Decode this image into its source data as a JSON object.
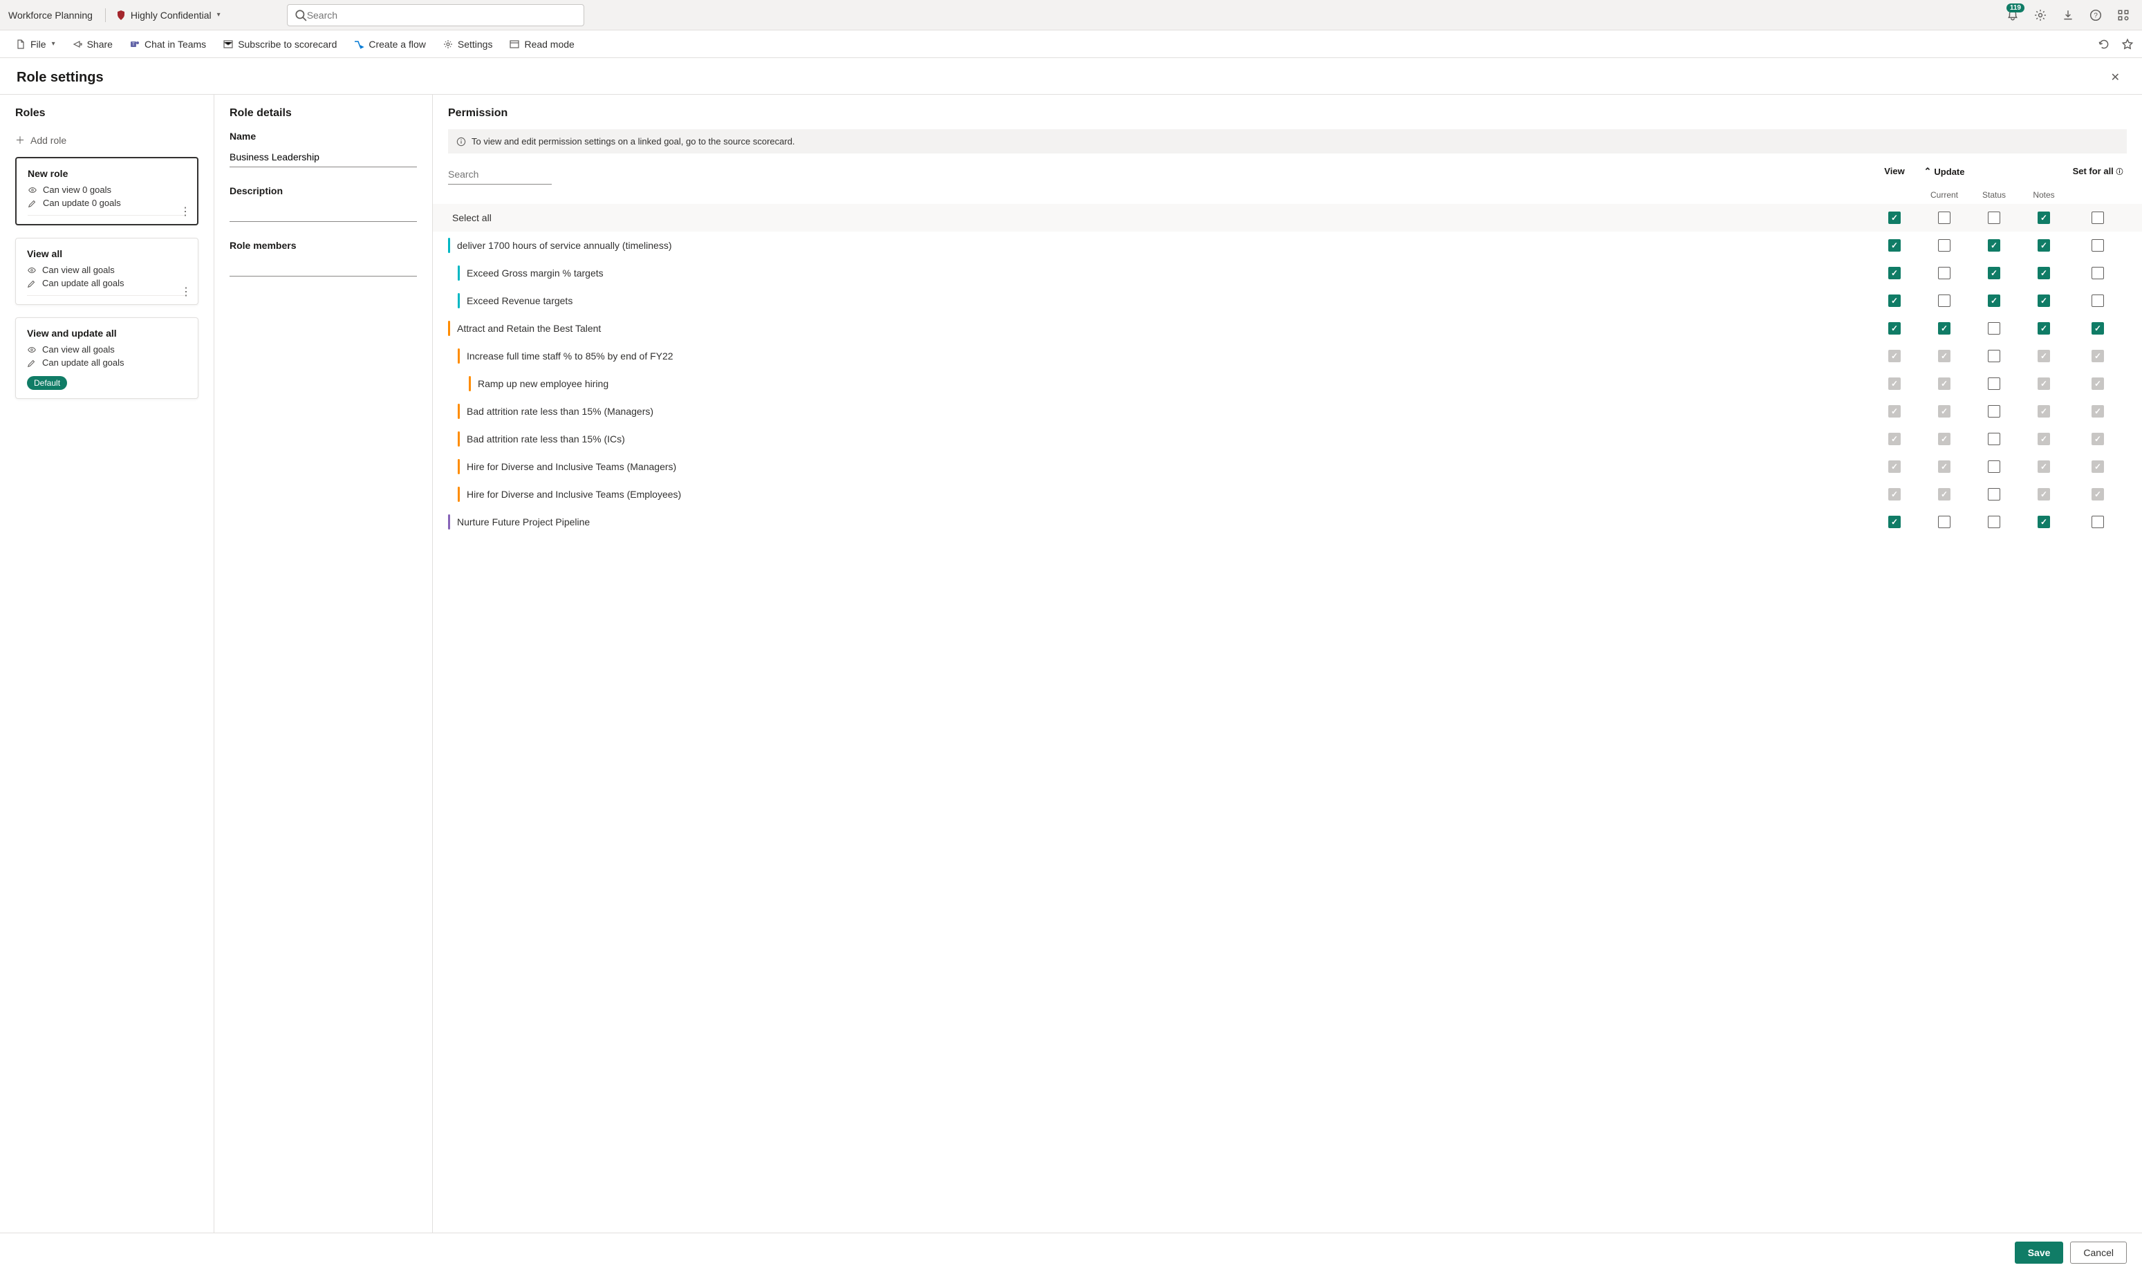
{
  "header": {
    "app_name": "Workforce Planning",
    "sensitivity": "Highly Confidential",
    "search_placeholder": "Search",
    "badge_count": "119"
  },
  "toolbar": {
    "file": "File",
    "share": "Share",
    "chat": "Chat in Teams",
    "subscribe": "Subscribe to scorecard",
    "flow": "Create a flow",
    "settings": "Settings",
    "readmode": "Read mode"
  },
  "panel": {
    "title": "Role settings",
    "save": "Save",
    "cancel": "Cancel"
  },
  "roles": {
    "heading": "Roles",
    "add": "Add role",
    "default_label": "Default",
    "cards": [
      {
        "name": "New role",
        "view_line": "Can view 0 goals",
        "update_line": "Can update 0 goals",
        "selected": true,
        "kebab": true
      },
      {
        "name": "View all",
        "view_line": "Can view all goals",
        "update_line": "Can update all goals",
        "selected": false,
        "kebab": true
      },
      {
        "name": "View and update all",
        "view_line": "Can view all goals",
        "update_line": "Can update all goals",
        "selected": false,
        "default": true
      }
    ]
  },
  "details": {
    "heading": "Role details",
    "name_label": "Name",
    "name_value": "Business Leadership",
    "desc_label": "Description",
    "members_label": "Role members"
  },
  "perm": {
    "heading": "Permission",
    "notice": "To view and edit permission settings on a linked goal, go to the source scorecard.",
    "search_placeholder": "Search",
    "col_view": "View",
    "col_update": "Update",
    "col_current": "Current",
    "col_status": "Status",
    "col_notes": "Notes",
    "col_setall": "Set for all",
    "select_all": "Select all",
    "rows": [
      {
        "label": "deliver 1700 hours of service annually (timeliness)",
        "color": "teal",
        "indent": 0,
        "view": "c",
        "current": "u",
        "status": "c",
        "notes": "c",
        "all": "u"
      },
      {
        "label": "Exceed Gross margin % targets",
        "color": "teal",
        "indent": 1,
        "view": "c",
        "current": "u",
        "status": "c",
        "notes": "c",
        "all": "u"
      },
      {
        "label": "Exceed Revenue targets",
        "color": "teal",
        "indent": 1,
        "view": "c",
        "current": "u",
        "status": "c",
        "notes": "c",
        "all": "u"
      },
      {
        "label": "Attract and Retain the Best Talent",
        "color": "orange",
        "indent": 0,
        "view": "c",
        "current": "c",
        "status": "u",
        "notes": "c",
        "all": "c"
      },
      {
        "label": "Increase full time staff % to 85% by end of FY22",
        "color": "orange",
        "indent": 1,
        "view": "d",
        "current": "d",
        "status": "u",
        "notes": "d",
        "all": "d"
      },
      {
        "label": "Ramp up new employee hiring",
        "color": "orange",
        "indent": 2,
        "view": "d",
        "current": "d",
        "status": "u",
        "notes": "d",
        "all": "d"
      },
      {
        "label": "Bad attrition rate less than 15% (Managers)",
        "color": "orange",
        "indent": 1,
        "view": "d",
        "current": "d",
        "status": "u",
        "notes": "d",
        "all": "d"
      },
      {
        "label": "Bad attrition rate less than 15% (ICs)",
        "color": "orange",
        "indent": 1,
        "view": "d",
        "current": "d",
        "status": "u",
        "notes": "d",
        "all": "d"
      },
      {
        "label": "Hire for Diverse and Inclusive Teams (Managers)",
        "color": "orange",
        "indent": 1,
        "view": "d",
        "current": "d",
        "status": "u",
        "notes": "d",
        "all": "d"
      },
      {
        "label": "Hire for Diverse and Inclusive Teams (Employees)",
        "color": "orange",
        "indent": 1,
        "view": "d",
        "current": "d",
        "status": "u",
        "notes": "d",
        "all": "d"
      },
      {
        "label": "Nurture Future Project Pipeline",
        "color": "purple",
        "indent": 0,
        "view": "c",
        "current": "u",
        "status": "u",
        "notes": "c",
        "all": "u"
      }
    ],
    "select_all_states": {
      "view": "c",
      "current": "u",
      "status": "u",
      "notes": "c",
      "all": "u"
    }
  }
}
